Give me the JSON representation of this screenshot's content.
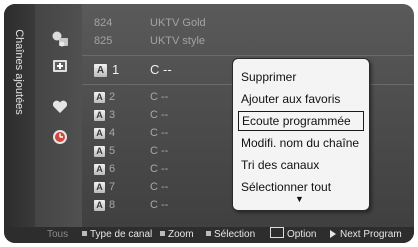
{
  "sidebar": {
    "label": "Chaînes ajoutées"
  },
  "icons": [
    "channel-list-icon",
    "add-channel-icon",
    "favourites-heart-icon",
    "programmed-clock-icon"
  ],
  "top_rows": [
    {
      "number": "824",
      "name": "UKTV Gold"
    },
    {
      "number": "825",
      "name": "UKTV style"
    }
  ],
  "selected_row": {
    "badge": "A",
    "number": "1",
    "name": "C --"
  },
  "rows": [
    {
      "badge": "A",
      "number": "2",
      "name": "C --"
    },
    {
      "badge": "A",
      "number": "3",
      "name": "C --"
    },
    {
      "badge": "A",
      "number": "4",
      "name": "C --"
    },
    {
      "badge": "A",
      "number": "5",
      "name": "C --"
    },
    {
      "badge": "A",
      "number": "6",
      "name": "C --"
    },
    {
      "badge": "A",
      "number": "7",
      "name": "C --"
    },
    {
      "badge": "A",
      "number": "8",
      "name": "C --"
    }
  ],
  "menu": {
    "items": [
      "Supprimer",
      "Ajouter aux favoris",
      "Ecoute programmée",
      "Modifi. nom du chaîne",
      "Tri des canaux",
      "Sélectionner tout"
    ],
    "selected": "Ecoute programmée",
    "more_arrow": "▼"
  },
  "footer": {
    "tous": "Tous",
    "type_canal": "Type de canal",
    "zoom": "Zoom",
    "selection": "Sélection",
    "option": "Option",
    "next_program": "Next Program"
  }
}
